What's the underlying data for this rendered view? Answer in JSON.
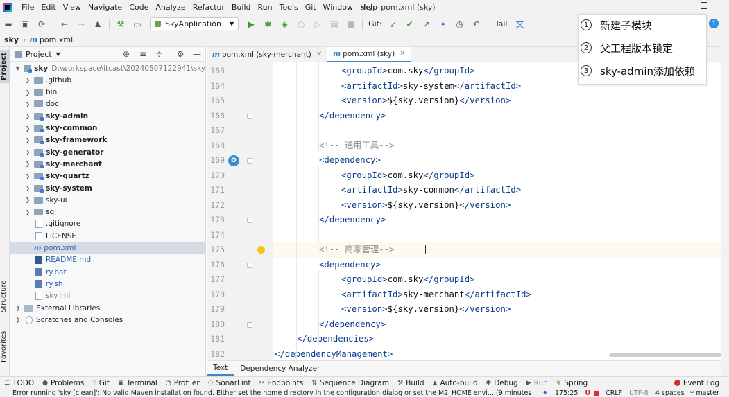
{
  "app": {
    "title": "sky - pom.xml (sky)",
    "menu": [
      "File",
      "Edit",
      "View",
      "Navigate",
      "Code",
      "Analyze",
      "Refactor",
      "Build",
      "Run",
      "Tools",
      "Git",
      "Window",
      "Help"
    ]
  },
  "toolbar": {
    "run_config": "SkyApplication",
    "git_label": "Git:",
    "tail_label": "Tail"
  },
  "breadcrumb": {
    "project": "sky",
    "file": "pom.xml"
  },
  "left_stripe": {
    "project": "Project",
    "structure": "Structure",
    "favorites": "Favorites"
  },
  "project_panel": {
    "header": "Project",
    "root_name": "sky",
    "root_path": "D:\\workspace\\itcast\\20240507122941\\sky",
    "items": [
      {
        "label": "github",
        "display": ".github",
        "kind": "folder"
      },
      {
        "label": "bin",
        "display": "bin",
        "kind": "folder"
      },
      {
        "label": "doc",
        "display": "doc",
        "kind": "folder"
      },
      {
        "label": "sky-admin",
        "display": "sky-admin",
        "kind": "module"
      },
      {
        "label": "sky-common",
        "display": "sky-common",
        "kind": "module"
      },
      {
        "label": "sky-framework",
        "display": "sky-framework",
        "kind": "module"
      },
      {
        "label": "sky-generator",
        "display": "sky-generator",
        "kind": "module"
      },
      {
        "label": "sky-merchant",
        "display": "sky-merchant",
        "kind": "module"
      },
      {
        "label": "sky-quartz",
        "display": "sky-quartz",
        "kind": "module"
      },
      {
        "label": "sky-system",
        "display": "sky-system",
        "kind": "module"
      },
      {
        "label": "sky-ui",
        "display": "sky-ui",
        "kind": "folder"
      },
      {
        "label": "sql",
        "display": "sql",
        "kind": "folder"
      },
      {
        "label": "gitignore",
        "display": ".gitignore",
        "kind": "file"
      },
      {
        "label": "license",
        "display": "LICENSE",
        "kind": "file"
      },
      {
        "label": "pom",
        "display": "pom.xml",
        "kind": "maven"
      },
      {
        "label": "readme",
        "display": "README.md",
        "kind": "md"
      },
      {
        "label": "ry-bat",
        "display": "ry.bat",
        "kind": "bat"
      },
      {
        "label": "ry-sh",
        "display": "ry.sh",
        "kind": "bat"
      },
      {
        "label": "sky-iml",
        "display": "sky.iml",
        "kind": "file"
      }
    ],
    "external_libraries": "External Libraries",
    "scratches": "Scratches and Consoles"
  },
  "editor_tabs": [
    {
      "label": "pom.xml (sky-merchant)",
      "active": false
    },
    {
      "label": "pom.xml (sky)",
      "active": true
    }
  ],
  "code_lines": [
    {
      "n": "163",
      "text": "<groupId>com.sky</groupId>"
    },
    {
      "n": "164",
      "text": "<artifactId>sky-system</artifactId>"
    },
    {
      "n": "165",
      "text": "<version>${sky.version}</version>"
    },
    {
      "n": "166",
      "text": "</dependency>"
    },
    {
      "n": "167",
      "text": ""
    },
    {
      "n": "168",
      "text": "<!-- 通用工具-->"
    },
    {
      "n": "169",
      "text": "<dependency>"
    },
    {
      "n": "170",
      "text": "<groupId>com.sky</groupId>"
    },
    {
      "n": "171",
      "text": "<artifactId>sky-common</artifactId>"
    },
    {
      "n": "172",
      "text": "<version>${sky.version}</version>"
    },
    {
      "n": "173",
      "text": "</dependency>"
    },
    {
      "n": "174",
      "text": ""
    },
    {
      "n": "175",
      "text": "<!-- 商家管理-->"
    },
    {
      "n": "176",
      "text": "<dependency>"
    },
    {
      "n": "177",
      "text": "<groupId>com.sky</groupId>"
    },
    {
      "n": "178",
      "text": "<artifactId>sky-merchant</artifactId>"
    },
    {
      "n": "179",
      "text": "<version>${sky.version}</version>"
    },
    {
      "n": "180",
      "text": "</dependency>"
    },
    {
      "n": "181",
      "text": "</dependencies>"
    },
    {
      "n": "182",
      "text": "</dependencyManagement>"
    }
  ],
  "editor_subtabs": [
    "Text",
    "Dependency Analyzer"
  ],
  "bottom_tools": {
    "todo": "TODO",
    "problems": "Problems",
    "git": "Git",
    "terminal": "Terminal",
    "profiler": "Profiler",
    "sonarlint": "SonarLint",
    "endpoints": "Endpoints",
    "sequence": "Sequence Diagram",
    "build": "Build",
    "autobuild": "Auto-build",
    "debug": "Debug",
    "run": "Run",
    "spring": "Spring",
    "eventlog": "Event Log"
  },
  "status": {
    "message": "Error running 'sky [clean]': No valid Maven installation found. Either set the home directory in the configuration dialog or set the M2_HOME envi... (9 minutes ago)",
    "position": "175:25",
    "line_sep": "CRLF",
    "encoding": "UTF-8",
    "indent": "4 spaces",
    "branch": "master"
  },
  "overlay": {
    "items": [
      {
        "num": "1",
        "text": "新建子模块"
      },
      {
        "num": "2",
        "text": "父工程版本锁定"
      },
      {
        "num": "3",
        "text": "sky-admin添加依赖"
      }
    ]
  }
}
